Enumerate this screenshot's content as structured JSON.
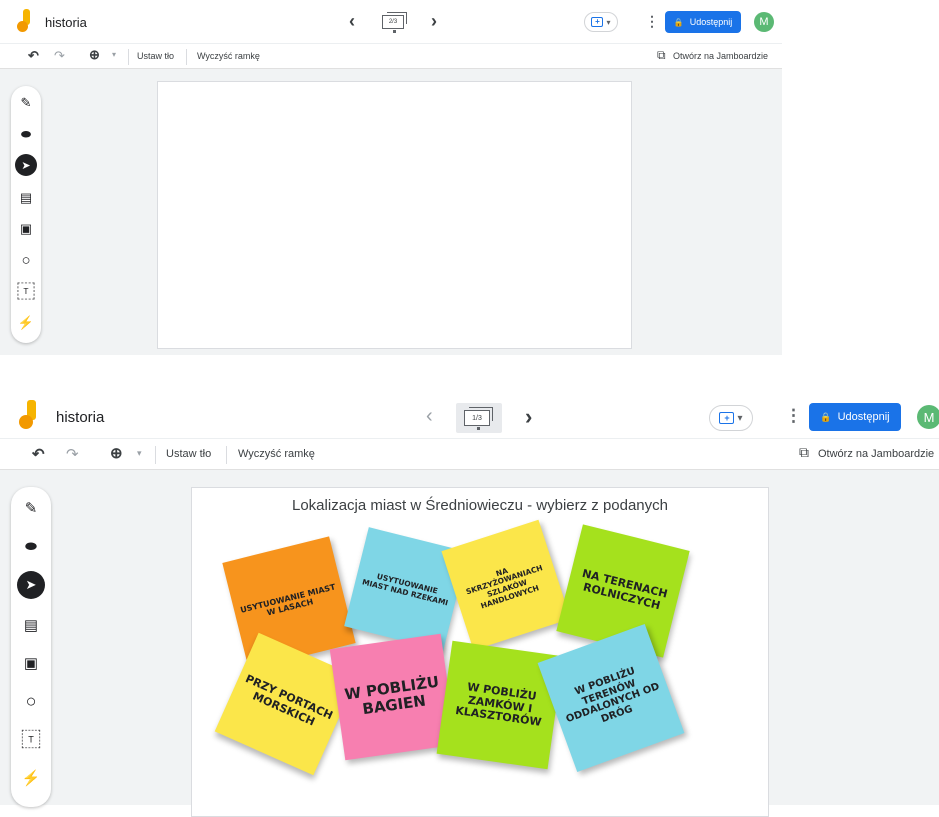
{
  "colors": {
    "orange": "#f7941d",
    "cyan": "#7fd6e6",
    "yellow": "#fbe64a",
    "green": "#a5e11d",
    "pink": "#f77fb0",
    "blue": "#1a73e8",
    "avatar": "#5bb974"
  },
  "icons": {
    "undo": "↶",
    "redo": "↷",
    "zoom": "⊕",
    "caret": "▾",
    "pen": "✎",
    "eraser": "⬬",
    "select": "➤",
    "note": "▤",
    "image": "▣",
    "circle": "○",
    "textbox": "T",
    "laser": "⚡",
    "lock": "🔒",
    "open": "⧉",
    "prev": "‹",
    "next": "›"
  },
  "screen1": {
    "app_title": "historia",
    "frame_counter": "2/3",
    "share_label": "Udostępnij",
    "avatar_initial": "M",
    "toolbar": {
      "set_background": "Ustaw tło",
      "clear_frame": "Wyczyść ramkę",
      "open_in_jamboard": "Otwórz na Jamboardzie"
    }
  },
  "screen2": {
    "app_title": "historia",
    "frame_counter": "1/3",
    "share_label": "Udostępnij",
    "avatar_initial": "M",
    "toolbar": {
      "set_background": "Ustaw tło",
      "clear_frame": "Wyczyść ramkę",
      "open_in_jamboard": "Otwórz na Jamboardzie"
    },
    "canvas_title": "Lokalizacja miast w Średniowieczu - wybierz z podanych",
    "notes": [
      {
        "text": "USYTUOWANIE MIAST W LASACH",
        "color": "#f7941d"
      },
      {
        "text": "USYTUOWANIE MIAST NAD RZEKAMI",
        "color": "#7fd6e6"
      },
      {
        "text": "NA SKRZYŻOWANIACH SZLAKÓW HANDLOWYCH",
        "color": "#fbe64a"
      },
      {
        "text": "NA TERENACH ROLNICZYCH",
        "color": "#a5e11d"
      },
      {
        "text": "PRZY PORTACH MORSKICH",
        "color": "#fbe64a"
      },
      {
        "text": "W POBLIŻU BAGIEN",
        "color": "#f77fb0"
      },
      {
        "text": "W POBLIŻU ZAMKÓW I KLASZTORÓW",
        "color": "#a5e11d"
      },
      {
        "text": "W POBLIŻU TERENÓW ODDALONYCH OD DRÓG",
        "color": "#7fd6e6"
      }
    ]
  }
}
